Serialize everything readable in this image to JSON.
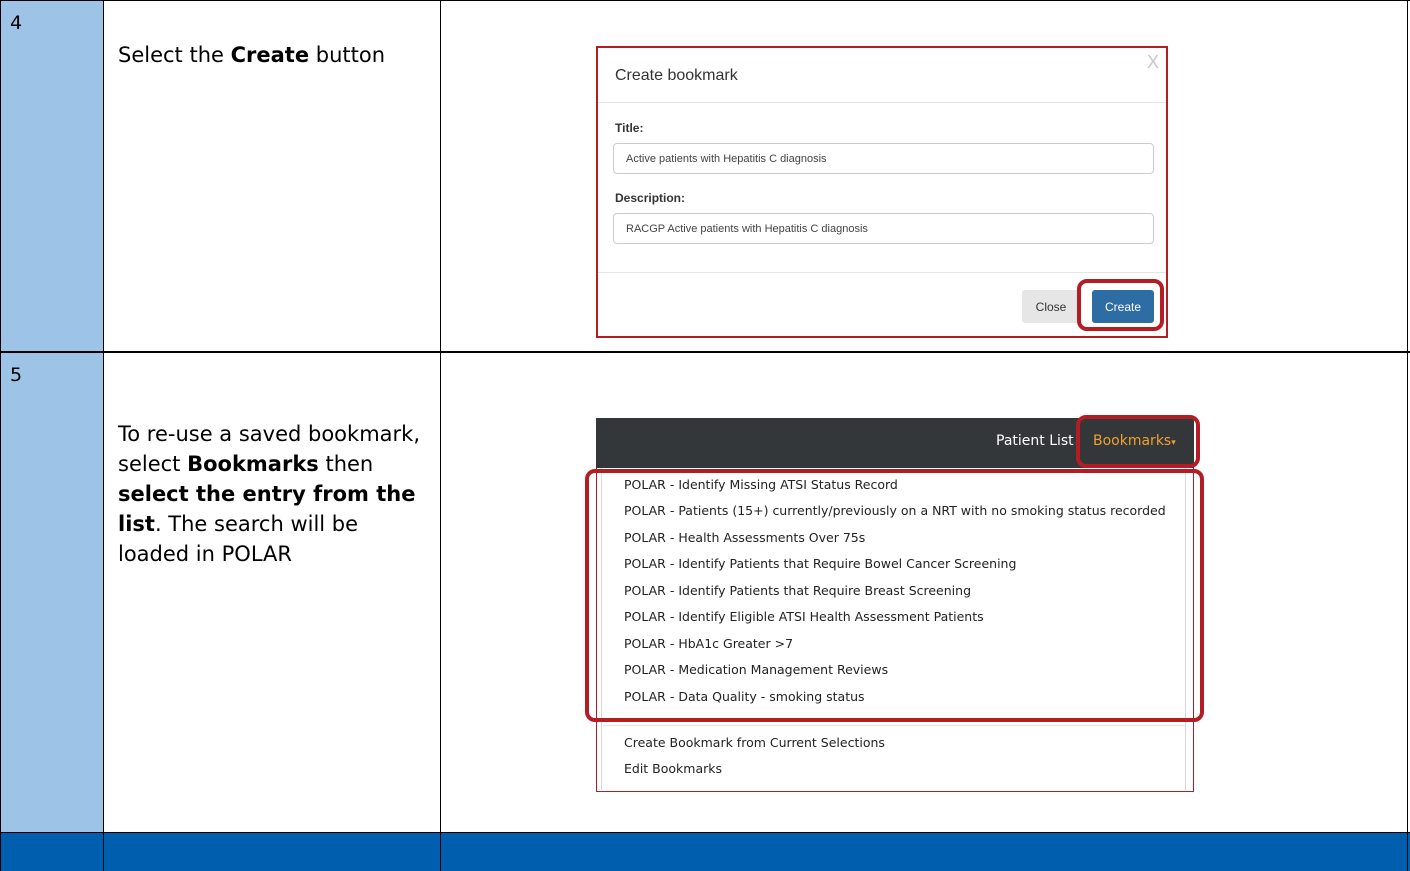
{
  "steps": [
    {
      "number": "4",
      "instruction_parts": [
        "Select the ",
        "Create",
        " button"
      ]
    },
    {
      "number": "5",
      "instruction_parts": [
        "To re-use a saved bookmark, select ",
        "Bookmarks",
        " then ",
        "select the entry from the list",
        ". The search will be loaded in POLAR"
      ]
    }
  ],
  "modal": {
    "title": "Create bookmark",
    "close_x": "X",
    "title_label": "Title:",
    "title_value": "Active patients with Hepatitis C diagnosis",
    "description_label": "Description:",
    "description_value": "RACGP Active patients with Hepatitis C diagnosis",
    "close_button": "Close",
    "create_button": "Create"
  },
  "bookmarks_menu": {
    "nav_patient_list": "Patient List",
    "nav_bookmarks": "Bookmarks",
    "items": [
      "POLAR - Identify Missing ATSI Status Record",
      "POLAR - Patients (15+) currently/previously on a NRT with no smoking status recorded",
      "POLAR - Health Assessments Over 75s",
      "POLAR - Identify Patients that Require Bowel Cancer Screening",
      "POLAR - Identify Patients that Require Breast Screening",
      "POLAR - Identify Eligible ATSI Health Assessment Patients",
      "POLAR - HbA1c Greater >7",
      "POLAR - Medication Management Reviews",
      "POLAR - Data Quality - smoking status"
    ],
    "actions": [
      "Create Bookmark from Current Selections",
      "Edit Bookmarks"
    ]
  },
  "colors": {
    "step_column": "#9dc3e6",
    "footer_band": "#005eae",
    "highlight": "#b51d24",
    "create_button": "#2e6da4",
    "navbar": "#333739",
    "bookmarks_link": "#f0a030"
  }
}
